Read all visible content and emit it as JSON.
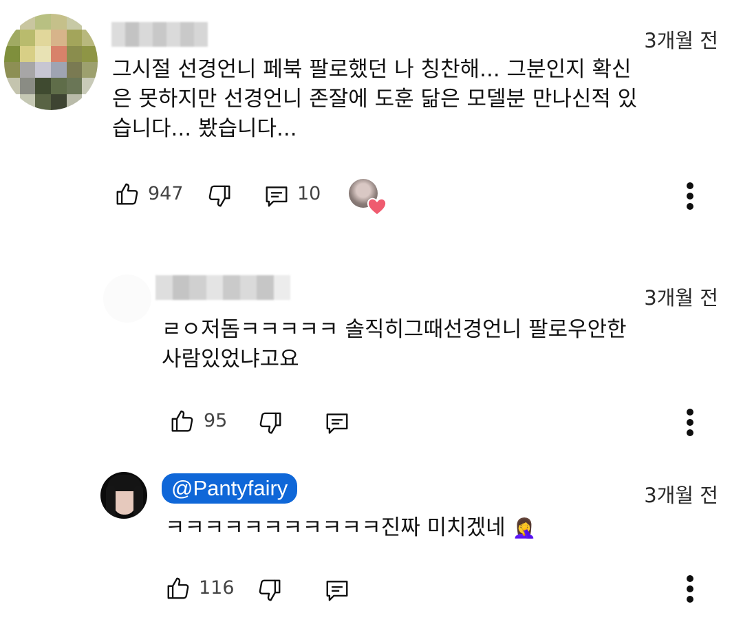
{
  "comments": [
    {
      "author": "",
      "time": "3개월 전",
      "lines": [
        "그시절 선경언니 페북 팔로했던 나 칭찬해... 그분인지 확신",
        "은 못하지만 선경언니 존잘에 도훈 닮은 모델분 만나신적 있",
        "습니다... 봤습니다..."
      ],
      "likes": "947",
      "replies": "10"
    },
    {
      "author": "",
      "time": "3개월 전",
      "lines": [
        "ㄹㅇ저돔ㅋㅋㅋㅋㅋ 솔직히그때선경언니 팔로우안한",
        "사람있었냐고요"
      ],
      "likes": "95"
    },
    {
      "author": "@Pantyfairy",
      "time": "3개월 전",
      "lines": [
        "ㅋㅋㅋㅋㅋㅋㅋㅋㅋㅋㅋ진짜 미치겠네"
      ],
      "emoji": "🤦‍♀️",
      "likes": "116"
    }
  ],
  "icons": {
    "like": "thumb-up-icon",
    "dislike": "thumb-down-icon",
    "reply": "reply-icon",
    "more": "more-vertical-icon",
    "heart": "creator-heart-icon"
  },
  "colors": {
    "handle_bg": "#0f67d8",
    "heart": "#ef5b6f"
  }
}
